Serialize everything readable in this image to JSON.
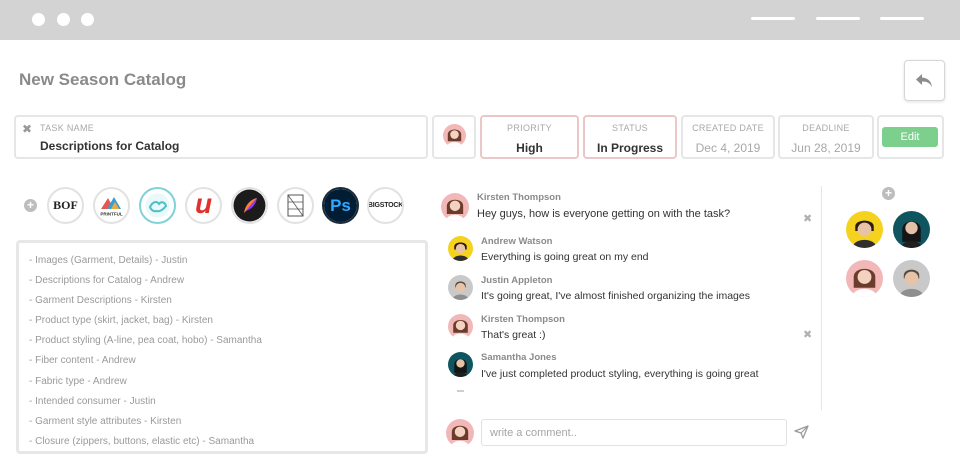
{
  "window": {
    "menu_lines": 3
  },
  "page": {
    "title": "New Season Catalog"
  },
  "task": {
    "label": "TASK NAME",
    "value": "Descriptions for Catalog"
  },
  "priority": {
    "label": "PRIORITY",
    "value": "High"
  },
  "status": {
    "label": "STATUS",
    "value": "In Progress"
  },
  "created": {
    "label": "CREATED DATE",
    "value": "Dec 4, 2019"
  },
  "deadline": {
    "label": "DEADLINE",
    "value": "Jun 28, 2019"
  },
  "actions": {
    "edit_label": "Edit"
  },
  "tools": [
    {
      "name": "bof-logo",
      "text": "BOF"
    },
    {
      "name": "printful-logo",
      "text": "PRINTFUL"
    },
    {
      "name": "handshake-logo",
      "text": ""
    },
    {
      "name": "udemy-logo",
      "text": "u"
    },
    {
      "name": "procreate-logo",
      "text": ""
    },
    {
      "name": "sketch-grid-logo",
      "text": ""
    },
    {
      "name": "photoshop-logo",
      "text": "Ps"
    },
    {
      "name": "bigstock-logo",
      "text": "BIGSTOCK"
    }
  ],
  "notes": [
    "- Images (Garment, Details) - Justin",
    "- Descriptions for Catalog - Andrew",
    "- Garment Descriptions  - Kirsten",
    "- Product type (skirt, jacket, bag) - Kirsten",
    "- Product styling (A-line, pea coat, hobo) - Samantha",
    "- Fiber content - Andrew",
    "- Fabric type - Andrew",
    "- Intended consumer - Justin",
    "- Garment style attributes - Kirsten",
    "- Closure (zippers, buttons, elastic etc) - Samantha"
  ],
  "comments": [
    {
      "name": "Kirsten Thompson",
      "text": "Hey guys, how is everyone getting on with the task?"
    },
    {
      "name": "Andrew Watson",
      "text": "Everything is going great on my end"
    },
    {
      "name": "Justin Appleton",
      "text": "It's going great, I've almost finished organizing the images"
    },
    {
      "name": "Kirsten Thompson",
      "text": "That's great :)"
    },
    {
      "name": "Samantha Jones",
      "text": "I've just completed product styling, everything is going great"
    }
  ],
  "comment_box": {
    "placeholder": "write a comment.."
  },
  "colors": {
    "accent_green": "#7dcf8d",
    "rose_border": "#ebc7c7",
    "chrome": "#d3d3d3",
    "avatar_pink": "#f2b8b8",
    "avatar_yellow": "#f5d21e",
    "avatar_teal": "#0f5560"
  }
}
